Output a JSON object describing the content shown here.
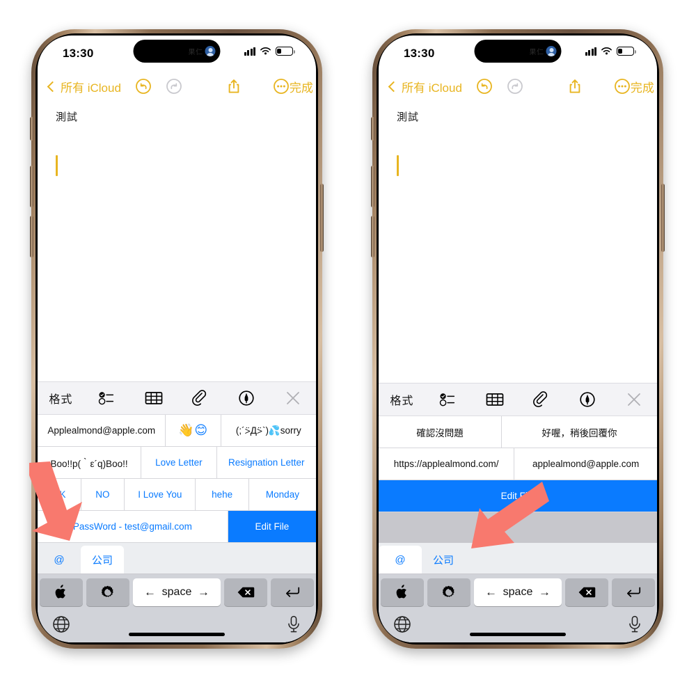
{
  "status_bar": {
    "time": "13:30",
    "island_label": "果仁",
    "avatar": "person-avatar",
    "signal_icon": "cellular-signal-icon",
    "wifi_icon": "wifi-icon",
    "battery_icon": "battery-low-icon"
  },
  "navbar": {
    "back_label": "所有 iCloud",
    "undo_icon": "undo-icon",
    "redo_icon": "redo-icon",
    "share_icon": "share-icon",
    "more_icon": "more-ellipsis-icon",
    "done_label": "完成"
  },
  "note": {
    "title": "測試",
    "cursor": "text-caret"
  },
  "format_toolbar": {
    "format_label": "格式",
    "checklist_icon": "checklist-icon",
    "table_icon": "table-icon",
    "attach_icon": "paperclip-icon",
    "markup_icon": "markup-pen-icon",
    "close_icon": "close-x-icon"
  },
  "left_phone": {
    "suggestion_rows": [
      [
        {
          "text": "Applealmond@apple.com",
          "style": "dark"
        },
        {
          "text": "👋😊",
          "style": "emoji"
        },
        {
          "text": "(;´⍩Д⍩`)💦sorry",
          "style": "dark"
        }
      ],
      [
        {
          "text": "Boo!!p(｀ε´q)Boo!!",
          "style": "dark"
        },
        {
          "text": "Love Letter",
          "style": "blue-text"
        },
        {
          "text": "Resignation Letter",
          "style": "blue-text"
        }
      ],
      [
        {
          "text": "OK",
          "style": "blue-text"
        },
        {
          "text": "NO",
          "style": "blue-text"
        },
        {
          "text": "I Love You",
          "style": "blue-text"
        },
        {
          "text": "hehe",
          "style": "blue-text"
        },
        {
          "text": "Monday",
          "style": "blue-text"
        }
      ],
      [
        {
          "text": "PassWord - test@gmail.com",
          "style": "blue-text"
        },
        {
          "text": "Edit File",
          "style": "blue-fill"
        }
      ]
    ],
    "candidates": [
      {
        "label": "@",
        "selected": false
      },
      {
        "label": "公司",
        "selected": true
      }
    ]
  },
  "right_phone": {
    "suggestion_rows": [
      [
        {
          "text": "確認沒問題",
          "style": "dark"
        },
        {
          "text": "好喔，稍後回覆你",
          "style": "dark"
        }
      ],
      [
        {
          "text": "https://applealmond.com/",
          "style": "dark"
        },
        {
          "text": "applealmond@apple.com",
          "style": "dark"
        }
      ],
      [
        {
          "text": "Edit File",
          "style": "blue-fill"
        }
      ]
    ],
    "candidates": [
      {
        "label": "@",
        "selected": true
      },
      {
        "label": "公司",
        "selected": false
      }
    ]
  },
  "keyboard": {
    "apple_key": "apple-logo-icon",
    "gear_key": "gear-icon",
    "space_label": "space",
    "left_arrow": "←",
    "right_arrow": "→",
    "delete_key": "delete-backspace-icon",
    "return_key": "return-icon",
    "globe_key": "globe-icon",
    "mic_key": "microphone-icon"
  },
  "annotations": {
    "arrow_color": "#F8796E",
    "left_arrow_name": "pointer-arrow-left",
    "right_arrow_name": "pointer-arrow-right"
  },
  "colors": {
    "accent_yellow": "#E8B521",
    "accent_blue": "#0A7BFF",
    "keyboard_bg": "#D1D3D9",
    "toolbar_bg": "#F3F3F6"
  }
}
